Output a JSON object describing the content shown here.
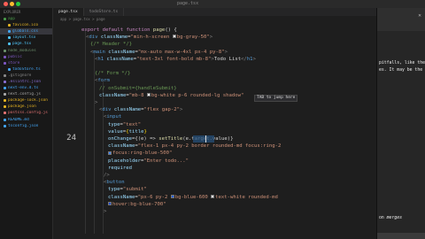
{
  "window": {
    "title": "page.tsx"
  },
  "sidebar": {
    "header": "EXPLORER",
    "items": [
      {
        "label": "app",
        "color": "#4a9a4a"
      },
      {
        "label": "favicon.ico",
        "color": "#e6b422"
      },
      {
        "label": "globals.css",
        "color": "#42a5f5",
        "selected": true
      },
      {
        "label": "layout.tsx",
        "color": "#4fc3f7"
      },
      {
        "label": "page.tsx",
        "color": "#4fc3f7"
      },
      {
        "label": "node_modules",
        "color": "#6b8f6b"
      },
      {
        "label": "public",
        "color": "#7e57c2"
      },
      {
        "label": "store",
        "color": "#7e57c2"
      },
      {
        "label": "todoStore.ts",
        "color": "#42a5f5"
      },
      {
        "label": ".gitignore",
        "color": "#888888"
      },
      {
        "label": ".eslintrc.json",
        "color": "#8a6fd3"
      },
      {
        "label": "next-env.d.ts",
        "color": "#42a5f5"
      },
      {
        "label": "next.config.js",
        "color": "#aaaaaa"
      },
      {
        "label": "package-lock.json",
        "color": "#e6b422"
      },
      {
        "label": "package.json",
        "color": "#e6b422"
      },
      {
        "label": "postcss.config.js",
        "color": "#e57373"
      },
      {
        "label": "README.md",
        "color": "#42a5f5"
      },
      {
        "label": "tsconfig.json",
        "color": "#42a5f5"
      }
    ]
  },
  "tabs": [
    {
      "label": "page.tsx",
      "active": true
    },
    {
      "label": "todoStore.ts",
      "active": false
    }
  ],
  "breadcrumb": "app > page.tsx > page",
  "editor": {
    "current_line": "24",
    "inline_hint": "TAB to jump here",
    "colors": {
      "keyword": "#c586c0",
      "tag": "#569cd6",
      "attr": "#9cdcfe",
      "string": "#ce9178",
      "func": "#dcdcaa",
      "punct": "#808080",
      "text": "#d4d4d4",
      "comment": "#6a9955",
      "brace": "#ffd700"
    },
    "lines": [
      {
        "n": "",
        "indent": 0,
        "segs": [
          [
            "keyword",
            "export default function "
          ],
          [
            "func",
            "page"
          ],
          [
            "text",
            "() {"
          ]
        ]
      },
      {
        "n": "",
        "indent": 1,
        "segs": [
          [
            "punct",
            "<"
          ],
          [
            "tag",
            "div "
          ],
          [
            "attr",
            "className"
          ],
          [
            "text",
            "="
          ],
          [
            "string",
            "\"min-h-screen "
          ],
          [
            "swatch",
            "#f3f4f6"
          ],
          [
            "string",
            "bg-gray-50\""
          ],
          [
            "punct",
            ">"
          ]
        ]
      },
      {
        "n": "",
        "indent": 2,
        "segs": [
          [
            "comment",
            "{/* Header */}"
          ]
        ]
      },
      {
        "n": "",
        "indent": 2,
        "segs": [
          [
            "punct",
            "<"
          ],
          [
            "tag",
            "main "
          ],
          [
            "attr",
            "className"
          ],
          [
            "text",
            "="
          ],
          [
            "string",
            "\"mx-auto max-w-4xl px-4 py-8\""
          ],
          [
            "punct",
            ">"
          ]
        ]
      },
      {
        "n": "",
        "indent": 3,
        "segs": [
          [
            "punct",
            "<"
          ],
          [
            "tag",
            "h1 "
          ],
          [
            "attr",
            "className"
          ],
          [
            "text",
            "="
          ],
          [
            "string",
            "\"text-3xl font-bold mb-8\""
          ],
          [
            "punct",
            ">"
          ],
          [
            "text",
            "Todo List"
          ],
          [
            "punct",
            "</"
          ],
          [
            "tag",
            "h1"
          ],
          [
            "punct",
            ">"
          ]
        ]
      },
      {
        "n": "",
        "indent": 0,
        "segs": []
      },
      {
        "n": "",
        "indent": 3,
        "segs": [
          [
            "comment",
            "{/* Form */}"
          ]
        ]
      },
      {
        "n": "",
        "indent": 3,
        "segs": [
          [
            "punct",
            "<"
          ],
          [
            "tag",
            "form"
          ]
        ]
      },
      {
        "n": "",
        "indent": 4,
        "segs": [
          [
            "comment",
            "// onSubmit={handleSubmit}"
          ]
        ]
      },
      {
        "n": "",
        "indent": 4,
        "segs": [
          [
            "attr",
            "className"
          ],
          [
            "text",
            "="
          ],
          [
            "string",
            "\"mb-8 "
          ],
          [
            "swatch",
            "#ffffff"
          ],
          [
            "string",
            "bg-white p-6 rounded-lg shadow\""
          ]
        ]
      },
      {
        "n": "",
        "indent": 3,
        "segs": [
          [
            "punct",
            ">"
          ]
        ]
      },
      {
        "n": "",
        "indent": 4,
        "segs": [
          [
            "punct",
            "<"
          ],
          [
            "tag",
            "div "
          ],
          [
            "attr",
            "className"
          ],
          [
            "text",
            "="
          ],
          [
            "string",
            "\"flex gap-2\""
          ],
          [
            "punct",
            ">"
          ]
        ]
      },
      {
        "n": "",
        "indent": 5,
        "segs": [
          [
            "punct",
            "<"
          ],
          [
            "tag",
            "input"
          ]
        ]
      },
      {
        "n": "",
        "indent": 6,
        "segs": [
          [
            "attr",
            "type"
          ],
          [
            "text",
            "="
          ],
          [
            "string",
            "\"text\""
          ]
        ]
      },
      {
        "n": "",
        "indent": 6,
        "segs": [
          [
            "attr",
            "value"
          ],
          [
            "text",
            "="
          ],
          [
            "brace",
            "{"
          ],
          [
            "attr",
            "title"
          ],
          [
            "brace",
            "}"
          ]
        ]
      },
      {
        "n": "24",
        "indent": 6,
        "segs": [
          [
            "attr",
            "onChange"
          ],
          [
            "text",
            "={(e) => "
          ],
          [
            "func",
            "setTitle"
          ],
          [
            "text",
            "(e.target.value)}"
          ]
        ]
      },
      {
        "n": "",
        "indent": 6,
        "segs": [
          [
            "attr",
            "className"
          ],
          [
            "text",
            "="
          ],
          [
            "string",
            "\"flex-1 px-4 py-2 border rounded-md focus:ring-2"
          ]
        ]
      },
      {
        "n": "",
        "indent": 6,
        "segs": [
          [
            "swatch",
            "#3b82f6"
          ],
          [
            "string",
            "focus:ring-blue-500\""
          ]
        ]
      },
      {
        "n": "",
        "indent": 6,
        "segs": [
          [
            "attr",
            "placeholder"
          ],
          [
            "text",
            "="
          ],
          [
            "string",
            "\"Enter todo...\""
          ]
        ]
      },
      {
        "n": "",
        "indent": 6,
        "segs": [
          [
            "attr",
            "required"
          ]
        ]
      },
      {
        "n": "",
        "indent": 5,
        "segs": [
          [
            "punct",
            "/>"
          ]
        ]
      },
      {
        "n": "",
        "indent": 5,
        "segs": [
          [
            "punct",
            "<"
          ],
          [
            "tag",
            "button"
          ]
        ]
      },
      {
        "n": "",
        "indent": 6,
        "segs": [
          [
            "attr",
            "type"
          ],
          [
            "text",
            "="
          ],
          [
            "string",
            "\"submit\""
          ]
        ]
      },
      {
        "n": "",
        "indent": 6,
        "segs": [
          [
            "attr",
            "className"
          ],
          [
            "text",
            "="
          ],
          [
            "string",
            "\"px-6 py-2 "
          ],
          [
            "swatch",
            "#2563eb"
          ],
          [
            "string",
            "bg-blue-600 "
          ],
          [
            "swatch",
            "#ffffff"
          ],
          [
            "string",
            "text-white rounded-md"
          ]
        ]
      },
      {
        "n": "",
        "indent": 6,
        "segs": [
          [
            "swatch",
            "#1d4ed8"
          ],
          [
            "string",
            "hover:bg-blue-700\""
          ]
        ]
      },
      {
        "n": "",
        "indent": 5,
        "segs": [
          [
            "punct",
            ">"
          ]
        ]
      }
    ]
  },
  "right_panel": {
    "line1": "pitfalls, like the",
    "line2": "es. It may be the",
    "bottom_prefix": "on ",
    "bottom_italic": "merges"
  }
}
